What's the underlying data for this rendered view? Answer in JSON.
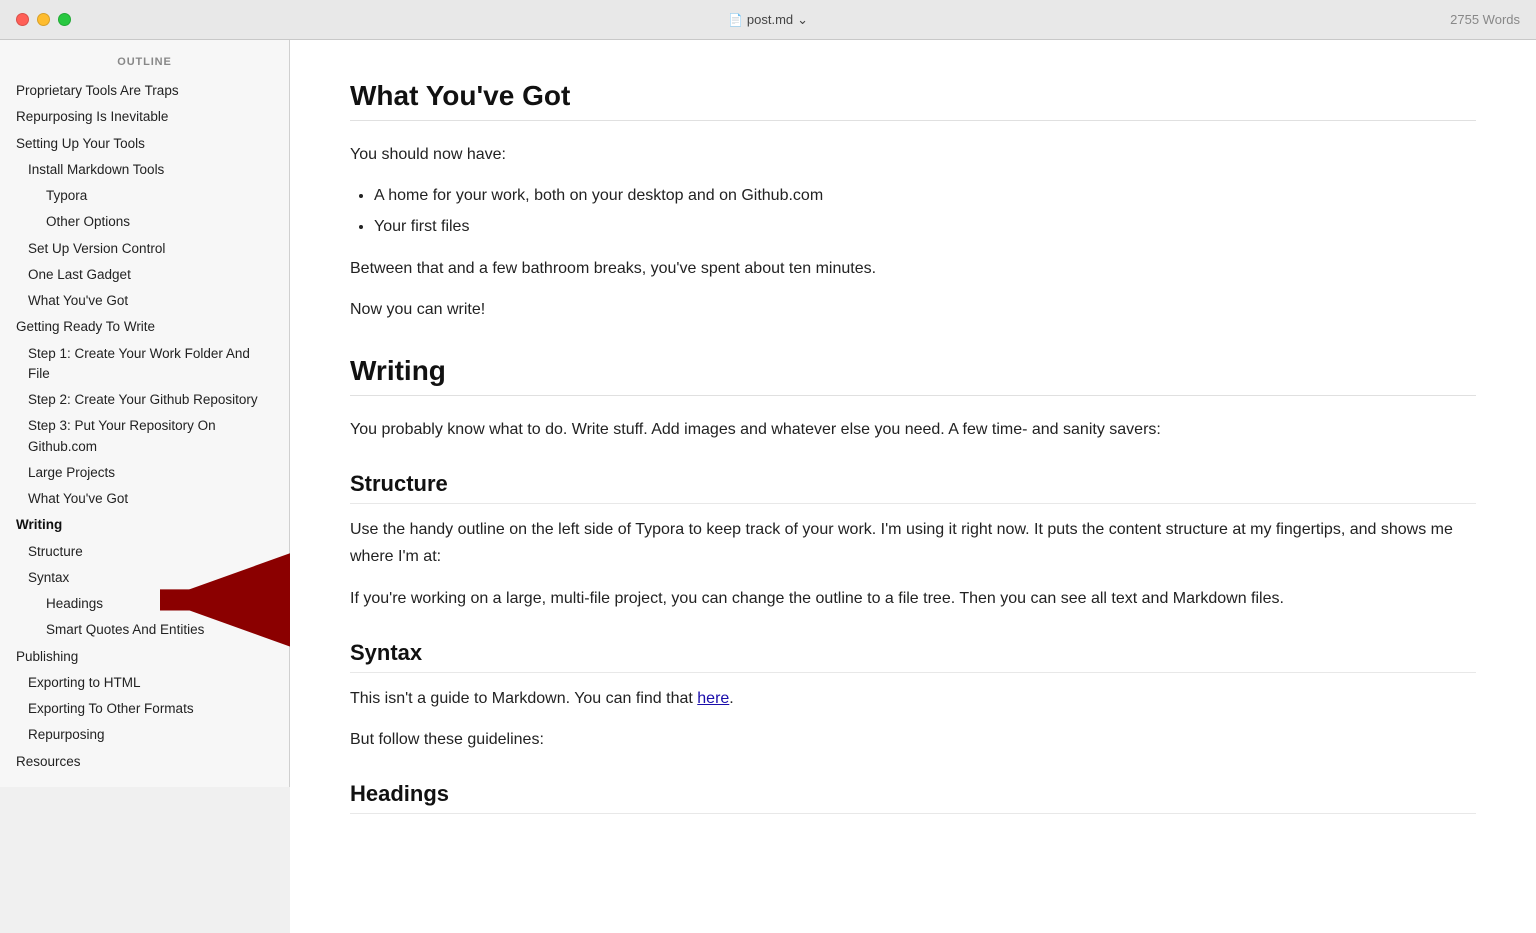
{
  "titlebar": {
    "filename": "post.md",
    "word_count": "2755 Words",
    "chevron": "›"
  },
  "sidebar": {
    "title": "OUTLINE",
    "items": [
      {
        "label": "Proprietary Tools Are Traps",
        "level": 0
      },
      {
        "label": "Repurposing Is Inevitable",
        "level": 0
      },
      {
        "label": "Setting Up Your Tools",
        "level": 0
      },
      {
        "label": "Install Markdown Tools",
        "level": 1
      },
      {
        "label": "Typora",
        "level": 2
      },
      {
        "label": "Other Options",
        "level": 2
      },
      {
        "label": "Set Up Version Control",
        "level": 1
      },
      {
        "label": "One Last Gadget",
        "level": 1
      },
      {
        "label": "What You've Got",
        "level": 1
      },
      {
        "label": "Getting Ready To Write",
        "level": 0
      },
      {
        "label": "Step 1: Create Your Work Folder And File",
        "level": 1
      },
      {
        "label": "Step 2: Create Your Github Repository",
        "level": 1
      },
      {
        "label": "Step 3: Put Your Repository On Github.com",
        "level": 1
      },
      {
        "label": "Large Projects",
        "level": 1
      },
      {
        "label": "What You've Got",
        "level": 1
      },
      {
        "label": "Writing",
        "level": 0,
        "active": true
      },
      {
        "label": "Structure",
        "level": 1
      },
      {
        "label": "Syntax",
        "level": 1
      },
      {
        "label": "Headings",
        "level": 2
      },
      {
        "label": "Smart Quotes And Entities",
        "level": 2
      },
      {
        "label": "Publishing",
        "level": 0
      },
      {
        "label": "Exporting to HTML",
        "level": 1
      },
      {
        "label": "Exporting To Other Formats",
        "level": 1
      },
      {
        "label": "Repurposing",
        "level": 1
      },
      {
        "label": "Resources",
        "level": 0
      }
    ]
  },
  "content": {
    "sections": [
      {
        "type": "h1",
        "text": "What You've Got"
      },
      {
        "type": "p",
        "text": "You should now have:"
      },
      {
        "type": "ul",
        "items": [
          "A home for your work, both on your desktop and on Github.com",
          "Your first files"
        ]
      },
      {
        "type": "p",
        "text": "Between that and a few bathroom breaks, you've spent about ten minutes."
      },
      {
        "type": "p",
        "text": "Now you can write!"
      },
      {
        "type": "h1",
        "text": "Writing"
      },
      {
        "type": "p",
        "text": "You probably know what to do. Write stuff. Add images and whatever else you need. A few time- and sanity savers:"
      },
      {
        "type": "h2",
        "text": "Structure"
      },
      {
        "type": "p",
        "text": "Use the handy outline on the left side of Typora to keep track of your work. I'm using it right now. It puts the content structure at my fingertips, and shows me where I'm at:"
      },
      {
        "type": "p",
        "text": "If you're working on a large, multi-file project, you can change the outline to a file tree. Then you can see all text and Markdown files."
      },
      {
        "type": "h2",
        "text": "Syntax"
      },
      {
        "type": "p",
        "text": "This isn't a guide to Markdown. You can find that here.",
        "link": {
          "text": "here",
          "url": "#"
        }
      },
      {
        "type": "p",
        "text": "But follow these guidelines:"
      },
      {
        "type": "h2",
        "text": "Headings"
      }
    ]
  },
  "arrow": {
    "label": "Writing arrow indicator"
  }
}
